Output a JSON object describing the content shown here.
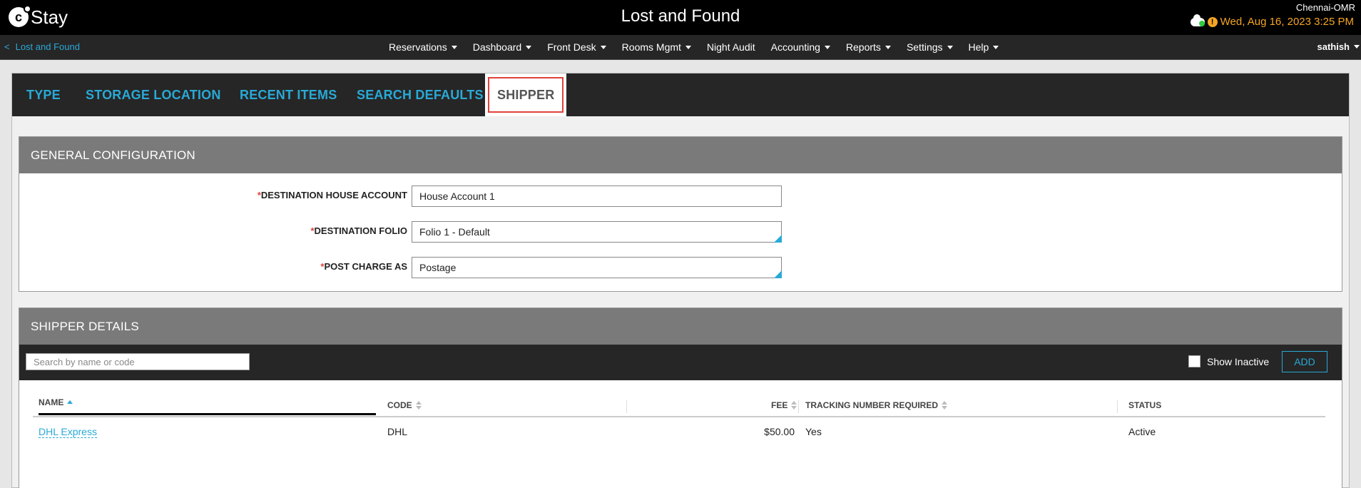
{
  "header": {
    "logo_mark": "c",
    "logo_text": "Stay",
    "title": "Lost and Found",
    "property": "Chennai-OMR",
    "datetime": "Wed, Aug 16, 2023 3:25 PM",
    "alert_glyph": "!"
  },
  "nav": {
    "back_chevron": "<",
    "back_label": "Lost and Found",
    "items": [
      {
        "label": "Reservations",
        "dropdown": true
      },
      {
        "label": "Dashboard",
        "dropdown": true
      },
      {
        "label": "Front Desk",
        "dropdown": true
      },
      {
        "label": "Rooms Mgmt",
        "dropdown": true
      },
      {
        "label": "Night Audit",
        "dropdown": false
      },
      {
        "label": "Accounting",
        "dropdown": true
      },
      {
        "label": "Reports",
        "dropdown": true
      },
      {
        "label": "Settings",
        "dropdown": true
      },
      {
        "label": "Help",
        "dropdown": true
      }
    ],
    "user": "sathish"
  },
  "tabs": {
    "type": "TYPE",
    "storage_location": "STORAGE LOCATION",
    "recent_items": "RECENT ITEMS",
    "search_defaults": "SEARCH DEFAULTS",
    "shipper": "SHIPPER",
    "active": "shipper"
  },
  "general": {
    "title": "GENERAL CONFIGURATION",
    "required_mark": "*",
    "fields": {
      "house_account": {
        "label": "DESTINATION HOUSE ACCOUNT",
        "value": "House Account 1"
      },
      "folio": {
        "label": "DESTINATION FOLIO",
        "value": "Folio 1 - Default"
      },
      "post_charge": {
        "label": "POST CHARGE AS",
        "value": "Postage"
      }
    }
  },
  "shipper": {
    "title": "SHIPPER DETAILS",
    "search_placeholder": "Search by name or code",
    "show_inactive_label": "Show Inactive",
    "add_label": "ADD",
    "columns": {
      "name": "NAME",
      "code": "CODE",
      "fee": "FEE",
      "tracking": "TRACKING NUMBER REQUIRED",
      "status": "STATUS"
    },
    "rows": [
      {
        "name": "DHL Express",
        "code": "DHL",
        "fee": "$50.00",
        "tracking": "Yes",
        "status": "Active"
      }
    ]
  },
  "colors": {
    "accent": "#29a9d6",
    "highlight": "#e0413a",
    "datetime": "#f5a623"
  }
}
